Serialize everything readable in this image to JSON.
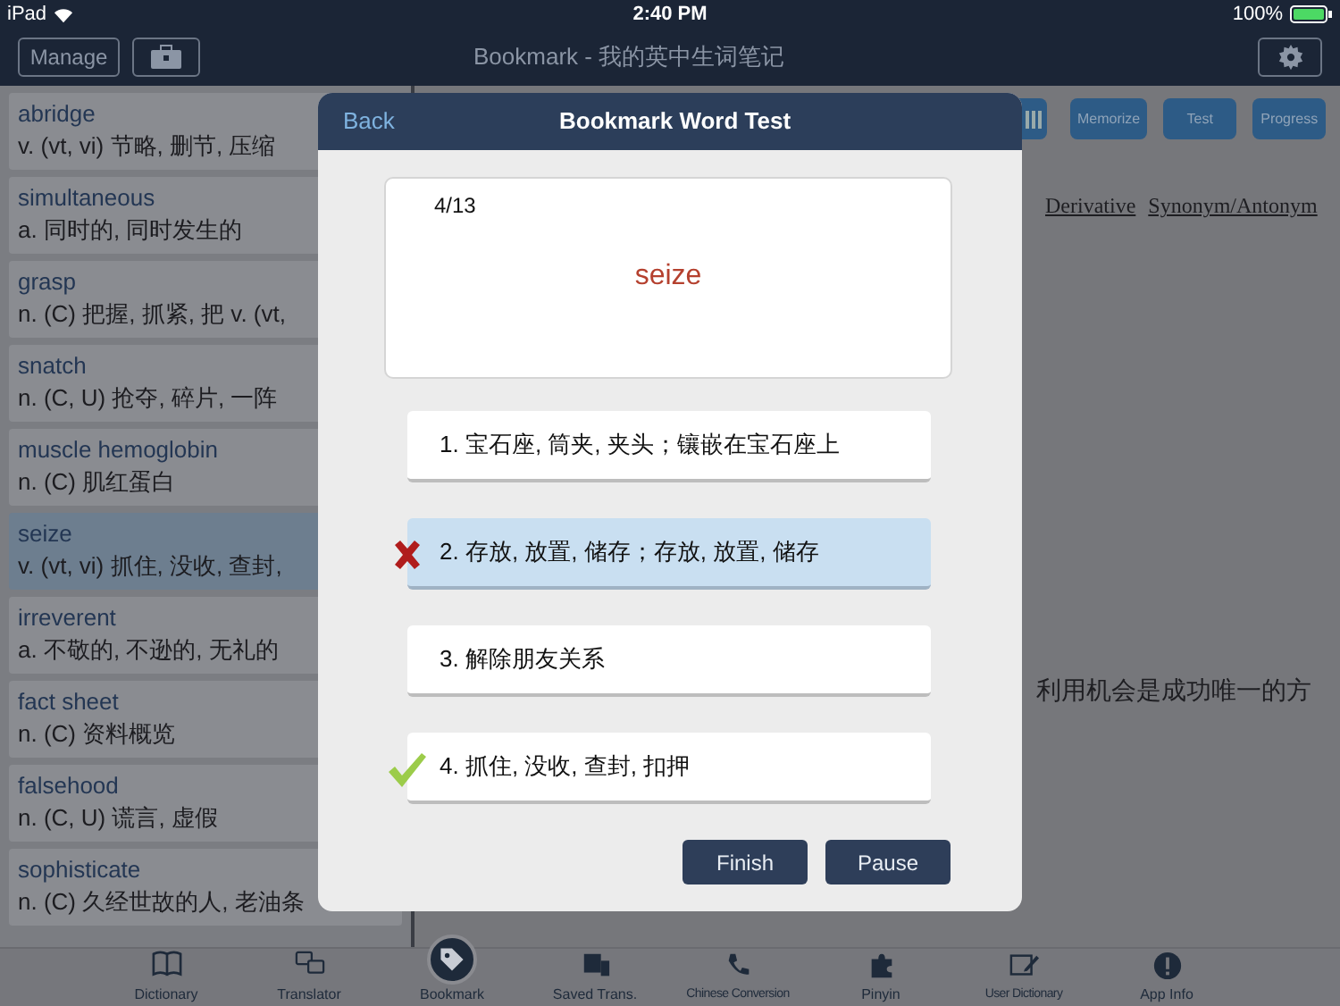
{
  "status_bar": {
    "device": "iPad",
    "time": "2:40 PM",
    "battery": "100%"
  },
  "nav_bar": {
    "manage": "Manage",
    "title": "Bookmark - 我的英中生词笔记"
  },
  "word_list": [
    {
      "word": "abridge",
      "definition": "v. (vt, vi) 节略, 删节, 压缩",
      "selected": false
    },
    {
      "word": "simultaneous",
      "definition": "a. 同时的, 同时发生的",
      "selected": false
    },
    {
      "word": "grasp",
      "definition": "n. (C) 把握, 抓紧, 把  v. (vt,",
      "selected": false
    },
    {
      "word": "snatch",
      "definition": "n. (C, U) 抢夺, 碎片, 一阵",
      "selected": false
    },
    {
      "word": "muscle hemoglobin",
      "definition": "n. (C) 肌红蛋白",
      "selected": false
    },
    {
      "word": "seize",
      "definition": "v. (vt, vi) 抓住, 没收, 查封,",
      "selected": true
    },
    {
      "word": "irreverent",
      "definition": "a. 不敬的, 不逊的, 无礼的",
      "selected": false
    },
    {
      "word": "fact sheet",
      "definition": "n. (C) 资料概览",
      "selected": false
    },
    {
      "word": "falsehood",
      "definition": "n. (C, U) 谎言, 虚假",
      "selected": false
    },
    {
      "word": "sophisticate",
      "definition": "n. (C) 久经世故的人, 老油条",
      "selected": false
    }
  ],
  "detail": {
    "toolbar": [
      "Memorize",
      "Test",
      "Progress"
    ],
    "links": [
      "Derivative",
      "Synonym/Antonym"
    ],
    "sentence": "利用机会是成功唯一的方"
  },
  "dialog": {
    "back": "Back",
    "title": "Bookmark Word Test",
    "progress": "4/13",
    "word": "seize",
    "options": [
      {
        "text": "1. 宝石座, 筒夹, 夹头；镶嵌在宝石座上",
        "selected": false,
        "wrong": false,
        "correct": false
      },
      {
        "text": "2. 存放, 放置, 储存；存放, 放置, 储存",
        "selected": true,
        "wrong": true,
        "correct": false
      },
      {
        "text": "3. 解除朋友关系",
        "selected": false,
        "wrong": false,
        "correct": false
      },
      {
        "text": "4. 抓住, 没收, 查封, 扣押",
        "selected": false,
        "wrong": false,
        "correct": true
      }
    ],
    "buttons": [
      "Finish",
      "Pause"
    ]
  },
  "tab_bar": [
    {
      "kind": "book",
      "label": "Dictionary",
      "selected": false
    },
    {
      "kind": "translate",
      "label": "Translator",
      "selected": false
    },
    {
      "kind": "tag",
      "label": "Bookmark",
      "selected": true
    },
    {
      "kind": "stack",
      "label": "Saved Trans.",
      "selected": false
    },
    {
      "kind": "phone",
      "label": "Chinese Conversion",
      "selected": false
    },
    {
      "kind": "puzzle",
      "label": "Pinyin",
      "selected": false
    },
    {
      "kind": "edit",
      "label": "User Dictionary",
      "selected": false
    },
    {
      "kind": "info",
      "label": "App Info",
      "selected": false
    }
  ]
}
